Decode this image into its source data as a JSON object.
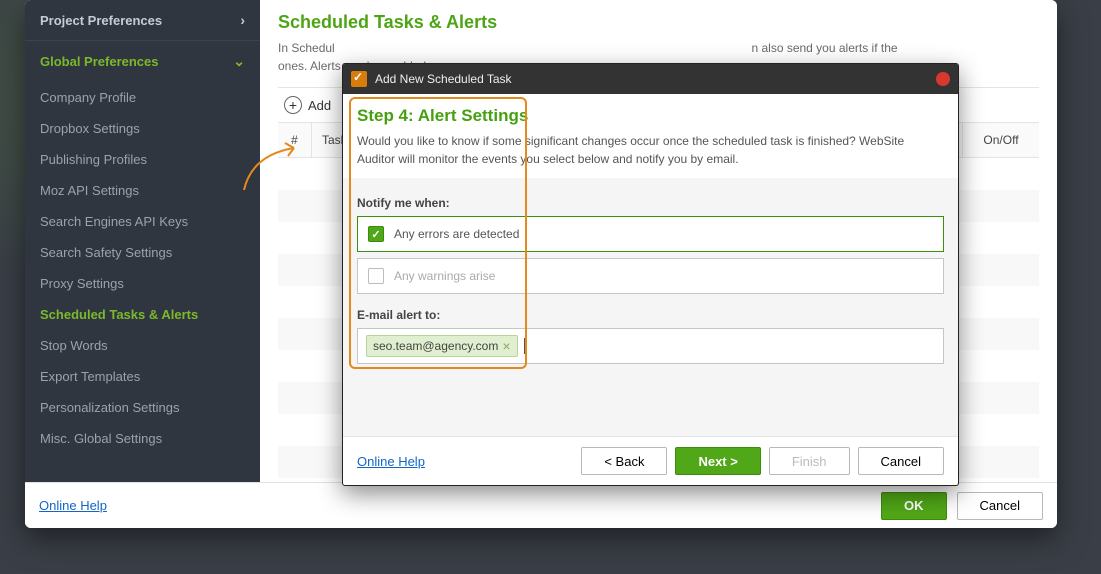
{
  "sidebar": {
    "project_header": "Project Preferences",
    "global_header": "Global Preferences",
    "items": [
      "Company Profile",
      "Dropbox Settings",
      "Publishing Profiles",
      "Moz API Settings",
      "Search Engines API Keys",
      "Search Safety Settings",
      "Proxy Settings",
      "Scheduled Tasks & Alerts",
      "Stop Words",
      "Export Templates",
      "Personalization Settings",
      "Misc. Global Settings"
    ]
  },
  "main": {
    "title": "Scheduled Tasks & Alerts",
    "desc_head": "In Schedul",
    "desc_tail": "n also send you alerts if the",
    "desc_tail2": "ones. Alerts can be enabled",
    "add": "Add",
    "col_num": "#",
    "col_task": "Task N",
    "col_onoff": "On/Off"
  },
  "bottom": {
    "help": "Online Help",
    "ok": "OK",
    "cancel": "Cancel"
  },
  "modal": {
    "title": "Add New Scheduled Task",
    "step_title": "Step 4: Alert Settings",
    "step_text": "Would you like to know if some significant changes occur once the scheduled task is finished? WebSite Auditor will monitor the events you select below and notify you by email.",
    "notify_label": "Notify me when:",
    "opt_errors": "Any errors are detected",
    "opt_warnings": "Any warnings arise",
    "email_label": "E-mail alert to:",
    "email_tag": "seo.team@agency.com",
    "help": "Online Help",
    "back": "< Back",
    "next": "Next >",
    "finish": "Finish",
    "cancel": "Cancel"
  }
}
